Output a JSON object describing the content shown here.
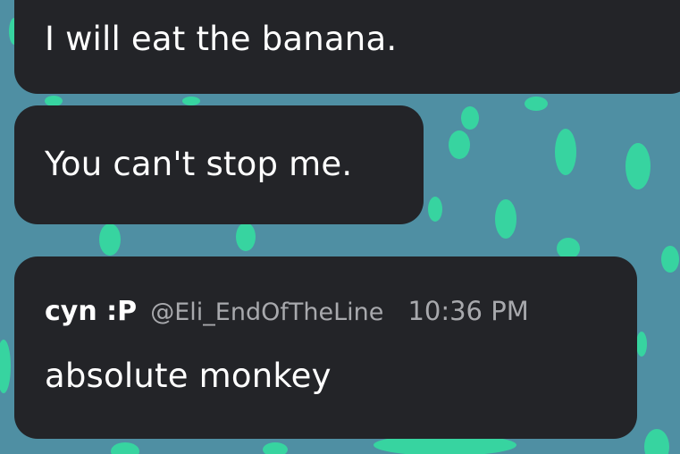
{
  "theme": {
    "background": "#4f8fa3",
    "dot_color": "#37d4a0",
    "bubble_color": "#232428",
    "muted_text": "#a8a9ad"
  },
  "messages": [
    {
      "text": "I will eat the banana."
    },
    {
      "text": "You can't stop me."
    },
    {
      "author": "cyn :P",
      "handle": "@Eli_EndOfTheLine",
      "timestamp": "10:36 PM",
      "text": "absolute monkey"
    }
  ]
}
